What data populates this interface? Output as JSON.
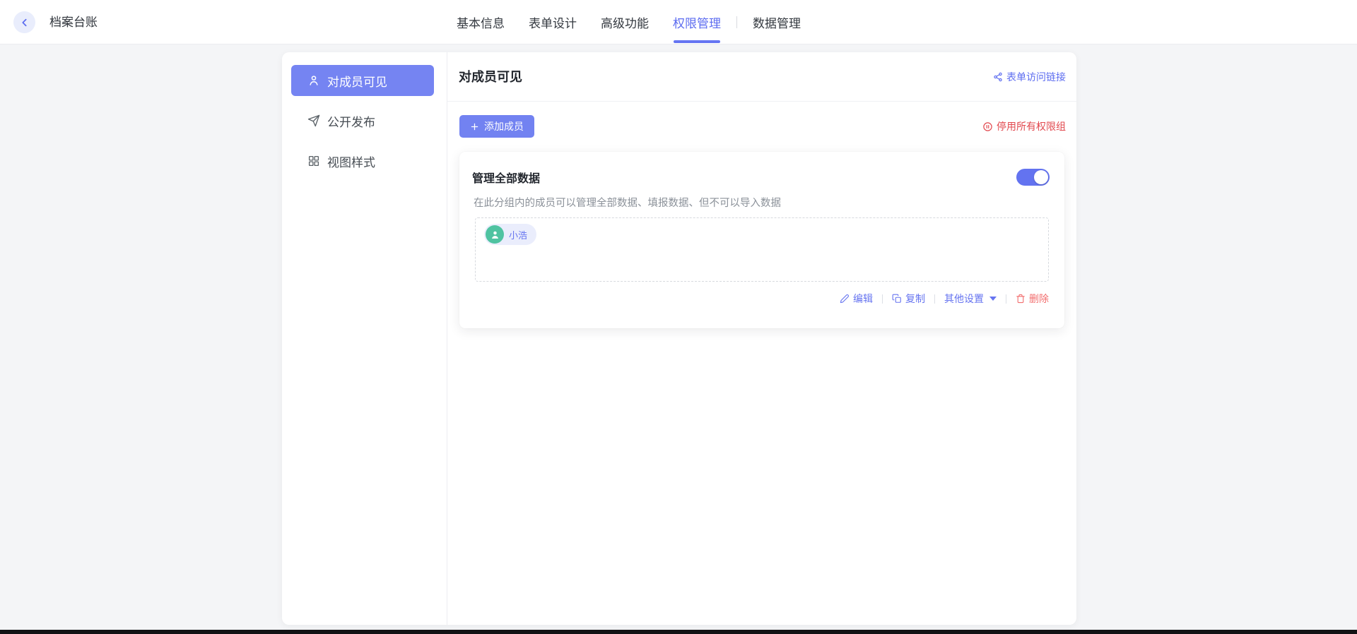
{
  "navbar": {
    "title": "档案台账",
    "tabs": [
      {
        "label": "基本信息",
        "active": false
      },
      {
        "label": "表单设计",
        "active": false
      },
      {
        "label": "高级功能",
        "active": false
      },
      {
        "label": "权限管理",
        "active": true
      },
      {
        "label": "数据管理",
        "active": false
      }
    ]
  },
  "sidebar": {
    "items": [
      {
        "label": "对成员可见",
        "icon": "user-icon",
        "active": true
      },
      {
        "label": "公开发布",
        "icon": "send-icon",
        "active": false
      },
      {
        "label": "视图样式",
        "icon": "layout-grid-icon",
        "active": false
      }
    ]
  },
  "content": {
    "heading": "对成员可见",
    "form_access_link": "表单访问链接",
    "add_member_button": "添加成员",
    "disable_all_groups": "停用所有权限组",
    "group": {
      "title": "管理全部数据",
      "description": "在此分组内的成员可以管理全部数据、填报数据、但不可以导入数据",
      "enabled": true,
      "members": [
        {
          "name": "小浩"
        }
      ],
      "actions": {
        "edit": "编辑",
        "copy": "复制",
        "more": "其他设置",
        "delete": "删除"
      }
    }
  },
  "colors": {
    "primary": "#6674f0",
    "sidebar_active_bg": "#7584f2",
    "tab_active": "#5c6cf0",
    "danger": "#e2484e",
    "delete_action": "#f26d6d",
    "avatar_green": "#4fc3a1",
    "page_bg": "#f4f5f7"
  }
}
